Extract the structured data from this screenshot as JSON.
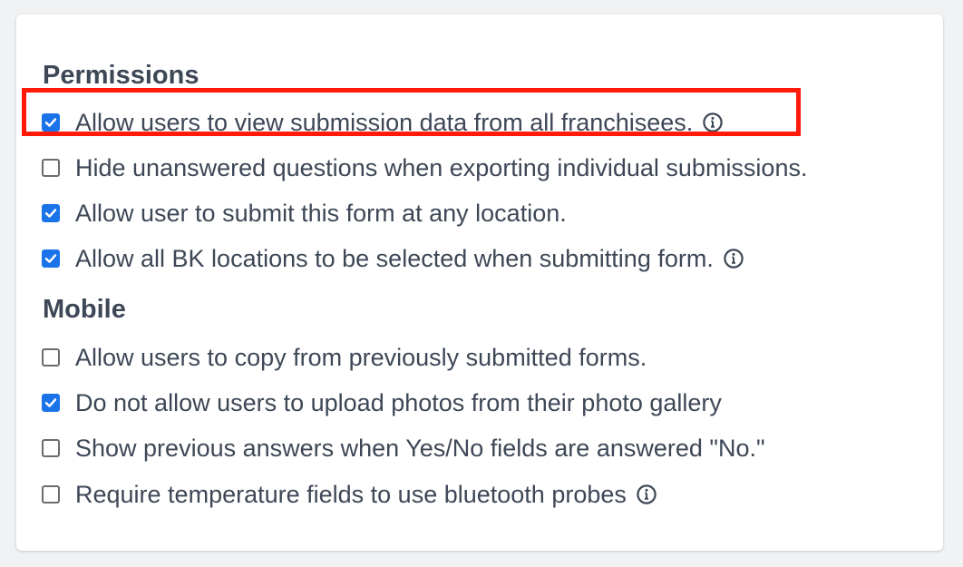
{
  "permissions": {
    "title": "Permissions",
    "items": [
      {
        "label": "Allow users to view submission data from all franchisees.",
        "checked": true,
        "info": true,
        "highlighted": true
      },
      {
        "label": "Hide unanswered questions when exporting individual submissions.",
        "checked": false,
        "info": false
      },
      {
        "label": "Allow user to submit this form at any location.",
        "checked": true,
        "info": false
      },
      {
        "label": "Allow all BK locations to be selected when submitting form.",
        "checked": true,
        "info": true
      }
    ]
  },
  "mobile": {
    "title": "Mobile",
    "items": [
      {
        "label": "Allow users to copy from previously submitted forms.",
        "checked": false,
        "info": false
      },
      {
        "label": "Do not allow users to upload photos from their photo gallery",
        "checked": true,
        "info": false
      },
      {
        "label": "Show previous answers when Yes/No fields are answered \"No.\"",
        "checked": false,
        "info": false
      },
      {
        "label": "Require temperature fields to use bluetooth probes",
        "checked": false,
        "info": true
      }
    ]
  },
  "colors": {
    "accent": "#1a73e8",
    "highlight_border": "#ff1a0a",
    "text": "#3d4756"
  },
  "icons": {
    "checkbox_check": "check-icon",
    "info": "info-circle-icon"
  }
}
